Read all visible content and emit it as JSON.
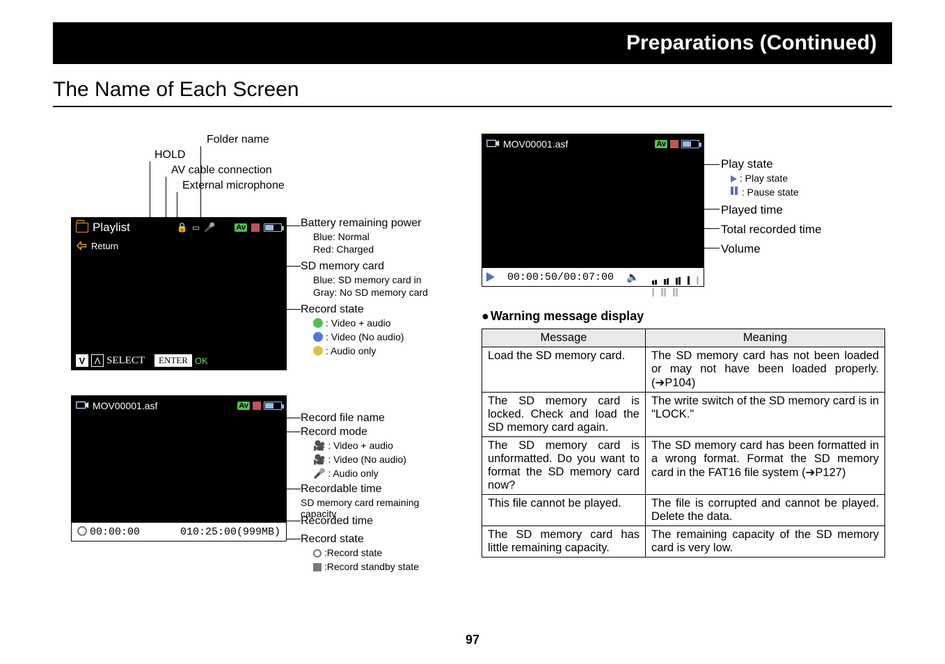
{
  "header": {
    "title": "Preparations (Continued)"
  },
  "mainhead": "The Name of Each Screen",
  "page_number": "97",
  "labels": {
    "folder_name": "Folder name",
    "hold": "HOLD",
    "av_cable": "AV cable connection",
    "ext_mic": "External microphone",
    "battery": "Battery remaining power",
    "battery_blue": "Blue: Normal",
    "battery_red": "Red: Charged",
    "sdcard": "SD memory card",
    "sdcard_blue": "Blue: SD memory card in",
    "sdcard_gray": "Gray: No SD memory card",
    "record_state": "Record state",
    "rs_va": ": Video + audio",
    "rs_v": ": Video (No audio)",
    "rs_a": ": Audio only",
    "record_file_name": "Record file name",
    "record_mode": "Record mode",
    "rm_va": ": Video + audio",
    "rm_v": ": Video (No audio)",
    "rm_a": ": Audio only",
    "recordable_time": "Recordable time",
    "sd_remaining": "SD memory card remaining capacity",
    "recorded_time": "Recorded time",
    "record_state2": "Record state",
    "rs2_rec": ":Record state",
    "rs2_standby": ":Record standby state"
  },
  "screen1": {
    "folder_text": "Playlist",
    "return_text": "Return",
    "select_label": "SELECT",
    "enter_label": "ENTER",
    "ok_label": "OK"
  },
  "screen2": {
    "filename": "MOV00001.asf",
    "rec_time": "00:00:00",
    "rec_remaining": "010:25:00(999MB)"
  },
  "screen3": {
    "filename": "MOV00001.asf",
    "time_display": "00:00:50/00:07:00"
  },
  "play_labels": {
    "play_state": "Play state",
    "play_state_play": ": Play state",
    "play_state_pause": ": Pause state",
    "played_time": "Played time",
    "total_recorded_time": "Total recorded time",
    "volume": "Volume"
  },
  "warning_heading": "Warning message display",
  "warning_table": {
    "col_message": "Message",
    "col_meaning": "Meaning",
    "rows": [
      {
        "msg": "Load the SD memory card.",
        "mean": "The SD memory card has not been loaded or may not have been loaded properly. (➔P104)"
      },
      {
        "msg": "The SD memory card is locked. Check and load the SD memory card again.",
        "mean": "The write switch of the SD memory card is in \"LOCK.\""
      },
      {
        "msg": "The SD memory card is unformatted. Do you want to format the SD memory card now?",
        "mean": "The SD memory card has been formatted in a wrong format. Format the SD memory card in the FAT16 file system (➔P127)"
      },
      {
        "msg": "This file cannot be played.",
        "mean": "The file is corrupted and cannot be played. Delete the data."
      },
      {
        "msg": "The SD memory card has little remaining capacity.",
        "mean": "The remaining capacity of the SD memory card is very low."
      }
    ]
  },
  "colors": {
    "av_green": "#50c050",
    "v_blue": "#4e78d4",
    "a_yellow": "#d9c44a"
  }
}
